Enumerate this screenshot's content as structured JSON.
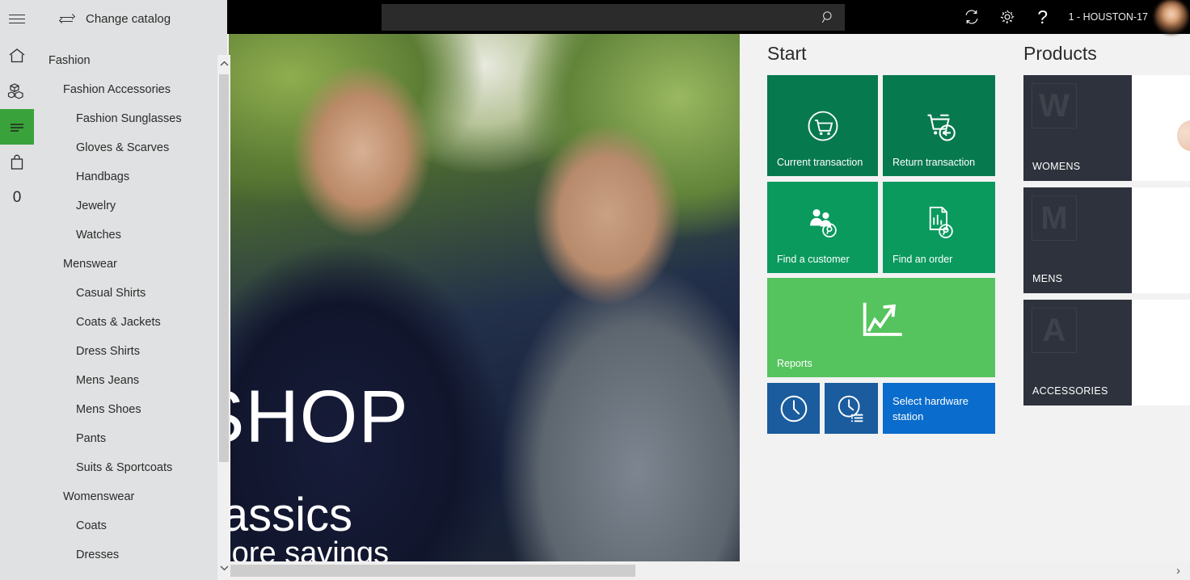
{
  "left_panel": {
    "menu_icon": "hamburger-icon",
    "change_catalog_label": "Change catalog",
    "rail": [
      {
        "icon": "home-icon",
        "name": "home",
        "active": false
      },
      {
        "icon": "products-cubes-icon",
        "name": "products",
        "active": false
      },
      {
        "icon": "list-lines-icon",
        "name": "catalog-list",
        "active": true
      },
      {
        "icon": "shopping-bag-icon",
        "name": "cart",
        "active": false
      },
      {
        "icon": "zero-count",
        "name": "count",
        "active": false,
        "text": "0"
      }
    ],
    "cart_count": "0",
    "nav_items": [
      {
        "label": "Fashion",
        "level": 0
      },
      {
        "label": "Fashion Accessories",
        "level": 1
      },
      {
        "label": "Fashion Sunglasses",
        "level": 2
      },
      {
        "label": "Gloves & Scarves",
        "level": 2
      },
      {
        "label": "Handbags",
        "level": 2
      },
      {
        "label": "Jewelry",
        "level": 2
      },
      {
        "label": "Watches",
        "level": 2
      },
      {
        "label": "Menswear",
        "level": 1
      },
      {
        "label": "Casual Shirts",
        "level": 2
      },
      {
        "label": "Coats & Jackets",
        "level": 2
      },
      {
        "label": "Dress Shirts",
        "level": 2
      },
      {
        "label": "Mens Jeans",
        "level": 2
      },
      {
        "label": "Mens Shoes",
        "level": 2
      },
      {
        "label": "Pants",
        "level": 2
      },
      {
        "label": "Suits & Sportcoats",
        "level": 2
      },
      {
        "label": "Womenswear",
        "level": 1
      },
      {
        "label": "Coats",
        "level": 2
      },
      {
        "label": "Dresses",
        "level": 2
      }
    ]
  },
  "topbar": {
    "search_value": "",
    "search_placeholder": "",
    "search_icon": "magnifier-icon",
    "refresh_icon": "refresh-icon",
    "settings_icon": "gear-icon",
    "help_icon": "question-mark-icon",
    "user_name": "",
    "store_register": "1 - HOUSTON-17",
    "avatar": "user-avatar"
  },
  "banner": {
    "line1": "SHOP",
    "line2": "classics",
    "line3": "more savings"
  },
  "start": {
    "title": "Start",
    "tiles": [
      {
        "label": "Current transaction",
        "icon": "cart-circle-icon",
        "color": "#07794f"
      },
      {
        "label": "Return transaction",
        "icon": "cart-return-icon",
        "color": "#07794f"
      },
      {
        "label": "Find a customer",
        "icon": "customer-search-icon",
        "color": "#0a9a5e"
      },
      {
        "label": "Find an order",
        "icon": "order-search-icon",
        "color": "#0a9a5e"
      },
      {
        "label": "Reports",
        "icon": "chart-arrow-icon",
        "color": "#55c45e"
      },
      {
        "label": "",
        "icon": "clock-icon",
        "color": "#1a5c9e"
      },
      {
        "label": "",
        "icon": "clock-list-icon",
        "color": "#1a5c9e"
      },
      {
        "label": "Select hardware station",
        "icon": "",
        "color": "#0a6ccc"
      }
    ]
  },
  "products": {
    "title": "Products",
    "tiles": [
      {
        "label": "WOMENS",
        "letter": "W"
      },
      {
        "label": "MENS",
        "letter": "M"
      },
      {
        "label": "ACCESSORIES",
        "letter": "A"
      }
    ]
  },
  "bottom": {
    "next_chevron": "›"
  },
  "scrollbar": {
    "up_arrow": "˄",
    "down_arrow": "˅"
  },
  "colors": {
    "accent_green": "#3aa23a",
    "tile_dark_green": "#07794f",
    "tile_mid_green": "#0a9a5e",
    "tile_light_green": "#55c45e",
    "tile_dark_blue": "#1a5c9e",
    "tile_blue": "#0a6ccc",
    "product_tile": "#2d323c",
    "panel_bg": "#e0e1e2",
    "page_bg": "#f2f2f2",
    "topbar_bg": "#000000"
  }
}
